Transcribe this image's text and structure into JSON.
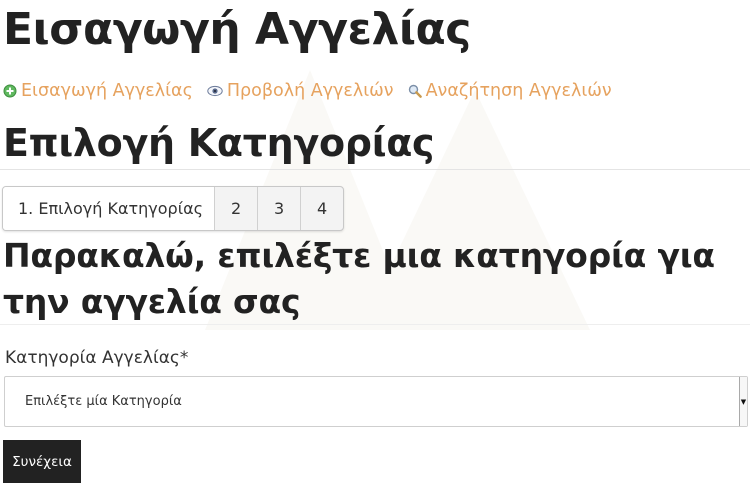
{
  "page": {
    "title": "Εισαγωγή Αγγελίας"
  },
  "nav": {
    "items": [
      {
        "label": "Εισαγωγή Αγγελίας",
        "icon": "add-icon"
      },
      {
        "label": "Προβολή Αγγελιών",
        "icon": "eye-icon"
      },
      {
        "label": "Αναζήτηση Αγγελιών",
        "icon": "search-icon"
      }
    ]
  },
  "section": {
    "title": "Επιλογή Κατηγορίας"
  },
  "steps": {
    "items": [
      {
        "label": "1.  Επιλογή Κατηγορίας"
      },
      {
        "label": "2"
      },
      {
        "label": "3"
      },
      {
        "label": "4"
      }
    ]
  },
  "form": {
    "prompt": "Παρακαλώ, επιλέξτε μια κατηγορία για την αγγελία σας",
    "category_label": "Κατηγορία Αγγελίας*",
    "category_selected": "Επιλέξτε μία Κατηγορία",
    "submit_label": "Συνέχεια"
  },
  "colors": {
    "link": "#e6a25e",
    "add_icon": "#5fb85f",
    "button_bg": "#222222"
  }
}
